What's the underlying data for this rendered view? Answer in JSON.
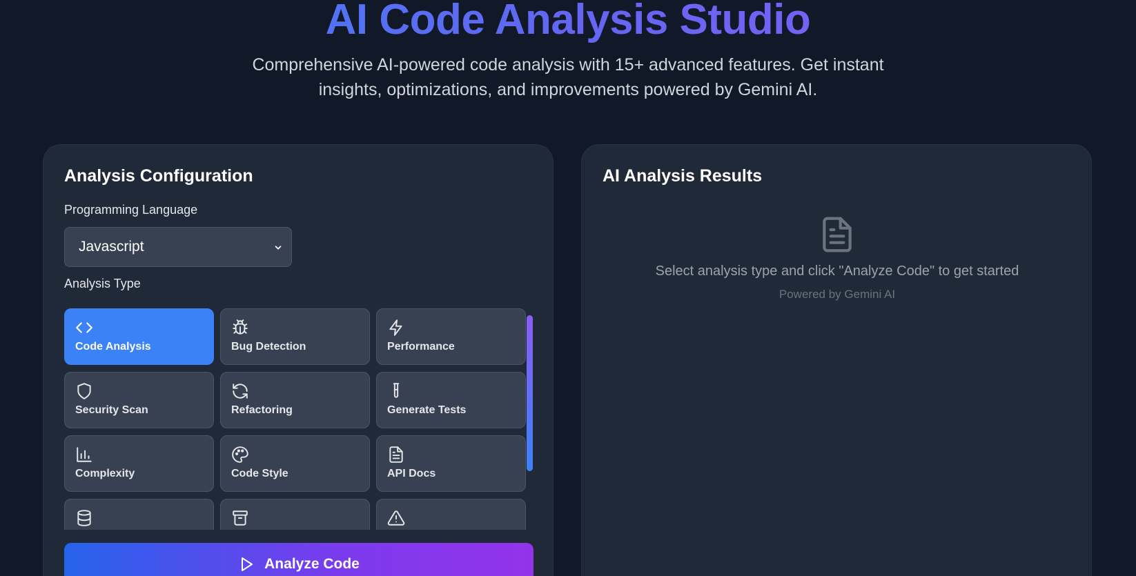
{
  "header": {
    "title": "AI Code Analysis Studio",
    "subtitle": "Comprehensive AI-powered code analysis with 15+ advanced features. Get instant insights, optimizations, and improvements powered by Gemini AI."
  },
  "config": {
    "title": "Analysis Configuration",
    "language_label": "Programming Language",
    "language_value": "Javascript",
    "analysis_type_label": "Analysis Type",
    "analysis_types": [
      {
        "label": "Code Analysis",
        "icon": "code-icon",
        "selected": true
      },
      {
        "label": "Bug Detection",
        "icon": "bug-icon",
        "selected": false
      },
      {
        "label": "Performance",
        "icon": "lightning-icon",
        "selected": false
      },
      {
        "label": "Security Scan",
        "icon": "shield-icon",
        "selected": false
      },
      {
        "label": "Refactoring",
        "icon": "refresh-icon",
        "selected": false
      },
      {
        "label": "Generate Tests",
        "icon": "test-tube-icon",
        "selected": false
      },
      {
        "label": "Complexity",
        "icon": "bar-chart-icon",
        "selected": false
      },
      {
        "label": "Code Style",
        "icon": "palette-icon",
        "selected": false
      },
      {
        "label": "API Docs",
        "icon": "document-icon",
        "selected": false
      },
      {
        "label": "",
        "icon": "database-icon",
        "selected": false
      },
      {
        "label": "",
        "icon": "archive-icon",
        "selected": false
      },
      {
        "label": "",
        "icon": "warning-icon",
        "selected": false
      }
    ],
    "analyze_button": "Analyze Code"
  },
  "results": {
    "title": "AI Analysis Results",
    "empty_icon": "document-icon",
    "empty_message": "Select analysis type and click \"Analyze Code\" to get started",
    "powered_by": "Powered by Gemini AI"
  },
  "colors": {
    "background": "#111827",
    "panel": "#1f2937",
    "card": "#374151",
    "accent": "#3b82f6",
    "gradient_end": "#9333ea"
  }
}
